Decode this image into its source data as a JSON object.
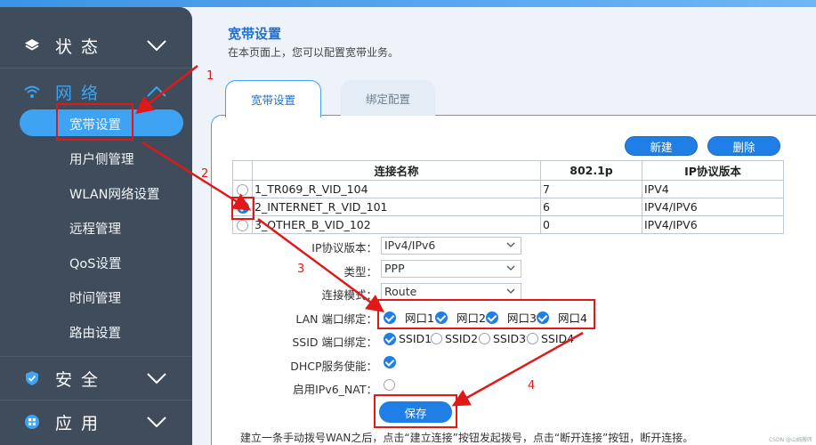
{
  "sidebar": {
    "sections": [
      {
        "label": "状态",
        "icon": "layers-icon"
      },
      {
        "label": "网络",
        "icon": "wifi-icon"
      },
      {
        "label": "安全",
        "icon": "shield-icon"
      },
      {
        "label": "应用",
        "icon": "apps-icon"
      }
    ],
    "network_items": [
      "宽带设置",
      "用户侧管理",
      "WLAN网络设置",
      "远程管理",
      "QoS设置",
      "时间管理",
      "路由设置"
    ],
    "active_item": "宽带设置",
    "accent_color": "#3ea3f2"
  },
  "main": {
    "title": "宽带设置",
    "description": "在本页面上，您可以配置宽带业务。",
    "tabs": [
      {
        "label": "宽带设置",
        "active": true
      },
      {
        "label": "绑定配置",
        "active": false
      }
    ],
    "buttons": {
      "new": "新建",
      "delete": "删除"
    },
    "table": {
      "columns": [
        "连接名称",
        "802.1p",
        "IP协议版本"
      ],
      "rows": [
        {
          "name": "1_TR069_R_VID_104",
          "p8021": "7",
          "ipver": "IPV4",
          "selected": false
        },
        {
          "name": "2_INTERNET_R_VID_101",
          "p8021": "6",
          "ipver": "IPV4/IPV6",
          "selected": true
        },
        {
          "name": "3_OTHER_B_VID_102",
          "p8021": "0",
          "ipver": "IPV4/IPV6",
          "selected": false
        }
      ]
    },
    "form": {
      "ip_version_label": "IP协议版本：",
      "ip_version_value": "IPv4/IPv6",
      "type_label": "类型：",
      "type_value": "PPP",
      "conn_mode_label": "连接模式：",
      "conn_mode_value": "Route",
      "lan_label": "LAN 端口绑定：",
      "lan_ports": [
        "网口1",
        "网口2",
        "网口3",
        "网口4"
      ],
      "ssid_label": "SSID 端口绑定：",
      "ssid_ports": [
        {
          "label": "SSID1",
          "checked": true
        },
        {
          "label": "SSID2",
          "checked": false
        },
        {
          "label": "SSID3",
          "checked": false
        },
        {
          "label": "SSID4",
          "checked": false
        }
      ],
      "dhcp_label": "DHCP服务使能：",
      "dhcp_checked": true,
      "ipv6nat_label": "启用IPv6_NAT：",
      "ipv6nat_checked": false
    },
    "save_label": "保存",
    "footnote": "建立一条手动拨号WAN之后，点击“建立连接”按钮发起拨号，点击“断开连接”按钮，断开连接。"
  },
  "annotations": {
    "color": "#e01818",
    "steps": [
      "1",
      "2",
      "3",
      "4"
    ]
  },
  "watermark": "CSDN @山姆搬砖"
}
